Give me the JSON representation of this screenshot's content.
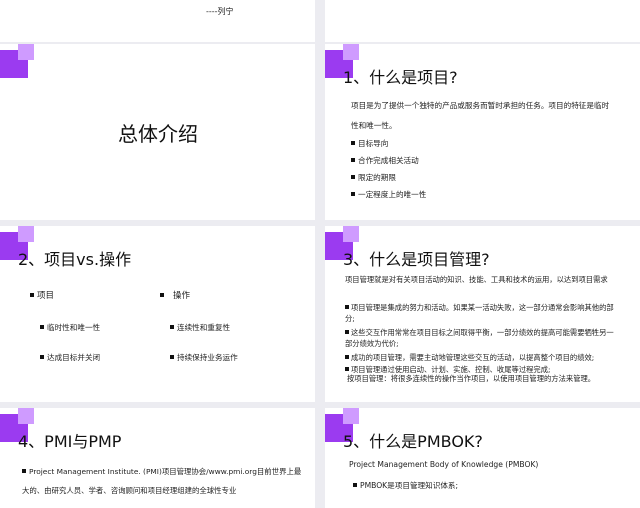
{
  "slide0": {
    "quote_author": "----列宁"
  },
  "slide1": {
    "heading": "总体介绍"
  },
  "slide2": {
    "title": "1、什么是项目?",
    "intro": "项目是为了提供一个独特的产品或服务而暂时承担的任务。项目的特征是临时性和唯一性。",
    "bullets": [
      "目标导向",
      "合作完成相关活动",
      "限定的期限",
      "一定程度上的唯一性"
    ]
  },
  "slide3": {
    "title": "2、项目vs.操作",
    "left_head": "项目",
    "right_head": "操作",
    "left_items": [
      "临时性和唯一性",
      "达成目标并关闭"
    ],
    "right_items": [
      "连续性和重复性",
      "持续保持业务运作"
    ]
  },
  "slide4": {
    "title": "3、什么是项目管理?",
    "definition": "项目管理就是对有关项目活动的知识、技能、工具和技术的运用，以达到项目需求",
    "points": [
      "项目管理是集成的努力和活动。如果某一活动失败，这一部分通常会影响其他的部分;",
      "这些交互作用常常在项目目标之间取得平衡，一部分绩效的提高可能需要牺牲另一部分绩效为代价;",
      "成功的项目管理，需要主动地管理这些交互的活动，以提高整个项目的绩效;",
      "项目管理通过使用启动、计划、实施、控制、收尾等过程完成;"
    ],
    "summary": "按项目管理：将很多连续性的操作当作项目，以使用项目管理的方法来管理。"
  },
  "slide5": {
    "title": "4、PMI与PMP",
    "body": "Project Management Institute. (PMI)项目管理协会/www.pmi.org目前世界上最大的、由研究人员、学者、咨询顾问和项目经理组建的全球性专业"
  },
  "slide6": {
    "title": "5、什么是PMBOK?",
    "subtitle": "Project Management Body of Knowledge (PMBOK)",
    "bullet": "PMBOK是项目管理知识体系;"
  },
  "colors": {
    "accent": "#9b3bf0",
    "accent_light": "#cf9bff",
    "background": "#ececf1"
  }
}
